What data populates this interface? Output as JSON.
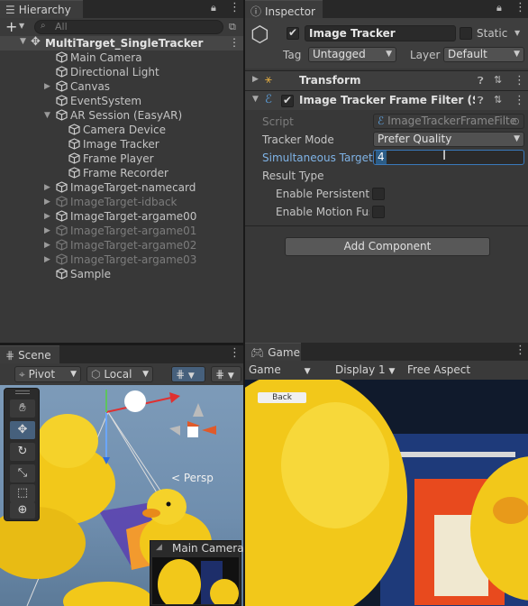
{
  "hierarchy": {
    "tab_label": "Hierarchy",
    "add_label": "+",
    "search_placeholder": "All",
    "root": "MultiTarget_SingleTracker",
    "items": [
      {
        "label": "Main Camera",
        "indent": 1,
        "arrow": "",
        "dim": false
      },
      {
        "label": "Directional Light",
        "indent": 1,
        "arrow": "",
        "dim": false
      },
      {
        "label": "Canvas",
        "indent": 1,
        "arrow": "▶",
        "dim": false
      },
      {
        "label": "EventSystem",
        "indent": 1,
        "arrow": "",
        "dim": false
      },
      {
        "label": "AR Session (EasyAR)",
        "indent": 1,
        "arrow": "▼",
        "dim": false
      },
      {
        "label": "Camera Device",
        "indent": 2,
        "arrow": "",
        "dim": false
      },
      {
        "label": "Image Tracker",
        "indent": 2,
        "arrow": "",
        "dim": false
      },
      {
        "label": "Frame Player",
        "indent": 2,
        "arrow": "",
        "dim": false
      },
      {
        "label": "Frame Recorder",
        "indent": 2,
        "arrow": "",
        "dim": false
      },
      {
        "label": "ImageTarget-namecard",
        "indent": 1,
        "arrow": "▶",
        "dim": false
      },
      {
        "label": "ImageTarget-idback",
        "indent": 1,
        "arrow": "▶",
        "dim": true
      },
      {
        "label": "ImageTarget-argame00",
        "indent": 1,
        "arrow": "▶",
        "dim": false
      },
      {
        "label": "ImageTarget-argame01",
        "indent": 1,
        "arrow": "▶",
        "dim": true
      },
      {
        "label": "ImageTarget-argame02",
        "indent": 1,
        "arrow": "▶",
        "dim": true
      },
      {
        "label": "ImageTarget-argame03",
        "indent": 1,
        "arrow": "▶",
        "dim": true
      },
      {
        "label": "Sample",
        "indent": 1,
        "arrow": "",
        "dim": false
      }
    ]
  },
  "inspector": {
    "tab_label": "Inspector",
    "object_name": "Image Tracker",
    "static_label": "Static",
    "tag_label": "Tag",
    "tag_value": "Untagged",
    "layer_label": "Layer",
    "layer_value": "Default",
    "transform_label": "Transform",
    "component_label": "Image Tracker Frame Filter (Scri",
    "script_label": "Script",
    "script_value": "ImageTrackerFrameFilte",
    "tracker_mode_label": "Tracker Mode",
    "tracker_mode_value": "Prefer Quality",
    "sim_target_label": "Simultaneous Target",
    "sim_target_value": "4",
    "result_type_label": "Result Type",
    "enable_persistent_label": "Enable Persistent T",
    "enable_motion_label": "Enable Motion Fus",
    "add_component_label": "Add Component"
  },
  "scene": {
    "tab_label": "Scene",
    "pivot_label": "Pivot",
    "local_label": "Local",
    "persp_label": "< Persp",
    "main_camera_label": "Main Camera"
  },
  "game": {
    "tab_label": "Game",
    "display_mode": "Game",
    "display_label": "Display 1",
    "aspect_label": "Free Aspect",
    "back_button_label": "Back"
  },
  "colors": {
    "accent": "#2c5d87",
    "duck": "#f2c81a",
    "sky": "#6f93b5"
  }
}
